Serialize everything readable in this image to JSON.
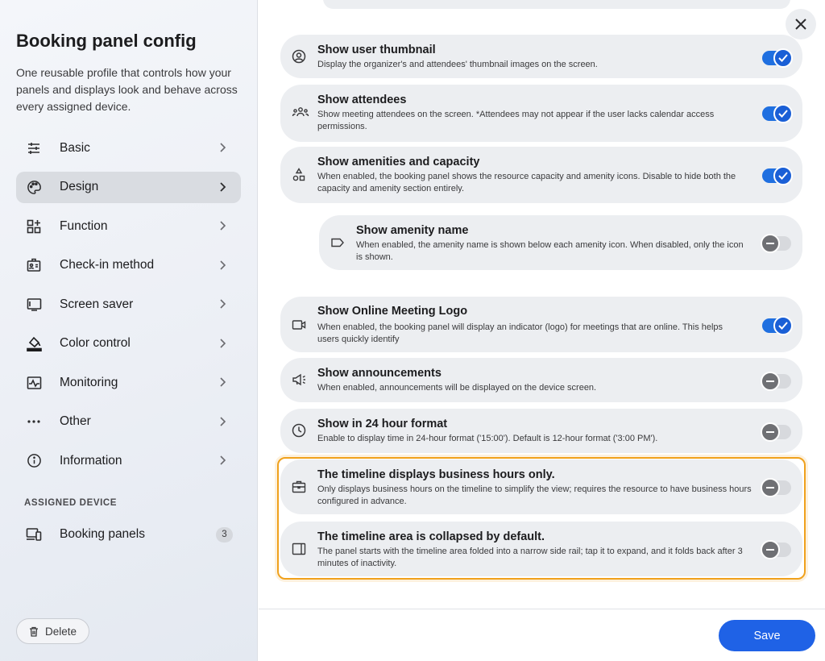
{
  "sidebar": {
    "title": "Booking panel config",
    "description": "One reusable profile that controls how your panels and displays look and behave across every assigned device.",
    "items": [
      {
        "label": "Basic",
        "icon": "sliders-icon"
      },
      {
        "label": "Design",
        "icon": "palette-icon",
        "active": true
      },
      {
        "label": "Function",
        "icon": "grid-plus-icon"
      },
      {
        "label": "Check-in method",
        "icon": "badge-icon"
      },
      {
        "label": "Screen saver",
        "icon": "monitor-icon"
      },
      {
        "label": "Color control",
        "icon": "paint-bucket-icon"
      },
      {
        "label": "Monitoring",
        "icon": "pulse-monitor-icon"
      },
      {
        "label": "Other",
        "icon": "dots-icon"
      },
      {
        "label": "Information",
        "icon": "info-icon"
      }
    ],
    "assigned_heading": "ASSIGNED DEVICE",
    "assigned_item": {
      "label": "Booking panels",
      "count": "3"
    },
    "delete_label": "Delete"
  },
  "settings": [
    {
      "title": "Show user thumbnail",
      "desc": "Display the organizer's and attendees' thumbnail images on the screen.",
      "enabled": true,
      "icon": "user-circle-icon"
    },
    {
      "title": "Show attendees",
      "desc": "Show meeting attendees on the screen. *Attendees may not appear if the user lacks calendar access permissions.",
      "enabled": true,
      "icon": "people-icon"
    },
    {
      "title": "Show amenities and capacity",
      "desc": "When enabled, the booking panel shows the resource capacity and amenity icons. Disable to hide both the capacity and amenity section entirely.",
      "enabled": true,
      "icon": "shapes-icon"
    },
    {
      "title": "Show amenity name",
      "desc": "When enabled, the amenity name is shown below each amenity icon. When disabled, only the icon is shown.",
      "enabled": false,
      "icon": "tag-icon"
    },
    {
      "title": "Show Online Meeting Logo",
      "desc": "When enabled, the booking panel will display an indicator (logo) for meetings that are online. This helps users quickly identify",
      "enabled": true,
      "icon": "video-icon"
    },
    {
      "title": "Show announcements",
      "desc": "When enabled, announcements will be displayed on the device screen.",
      "enabled": false,
      "icon": "megaphone-icon"
    },
    {
      "title": "Show in 24 hour format",
      "desc": "Enable to display time in 24-hour format ('15:00'). Default is 12-hour format ('3:00 PM').",
      "enabled": false,
      "icon": "clock-icon"
    },
    {
      "title": "The timeline displays business hours only.",
      "desc": "Only displays business hours on the timeline to simplify the view; requires the resource to have business hours configured in advance.",
      "enabled": false,
      "icon": "briefcase-icon"
    },
    {
      "title": "The timeline area is collapsed by default.",
      "desc": "The panel starts with the timeline area folded into a narrow side rail; tap it to expand, and it folds back after 3 minutes of inactivity.",
      "enabled": false,
      "icon": "side-panel-icon"
    }
  ],
  "footer": {
    "save_label": "Save"
  },
  "colors": {
    "accent": "#1f62e6",
    "highlight": "#f0a11c",
    "card": "#eceef1"
  }
}
